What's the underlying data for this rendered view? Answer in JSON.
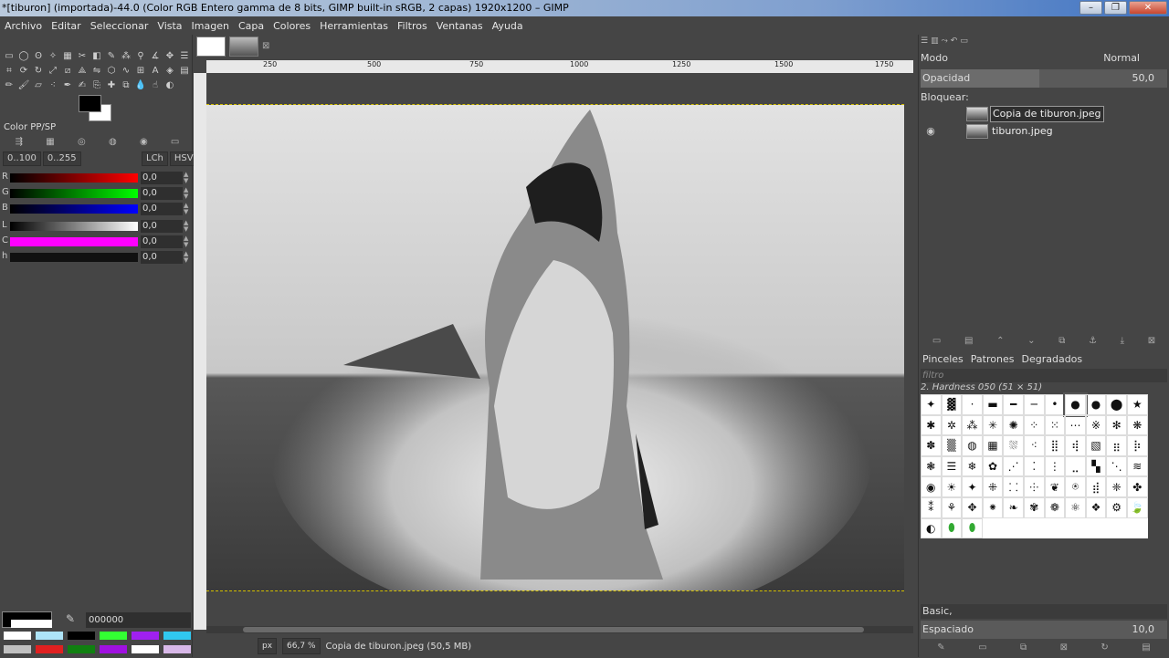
{
  "window": {
    "title": "*[tiburon] (importada)-44.0 (Color RGB Entero gamma de 8 bits, GIMP built-in sRGB, 2 capas) 1920x1200 – GIMP",
    "minimize": "–",
    "maximize": "❐",
    "close": "✕"
  },
  "menu": [
    "Archivo",
    "Editar",
    "Seleccionar",
    "Vista",
    "Imagen",
    "Capa",
    "Colores",
    "Herramientas",
    "Filtros",
    "Ventanas",
    "Ayuda"
  ],
  "color_dock": {
    "title": "Color PP/SP",
    "range1": "0..100",
    "range2": "0..255",
    "mode1": "LCh",
    "mode2": "HSV",
    "channels": [
      {
        "label": "R",
        "value": "0,0",
        "color": "#e00000"
      },
      {
        "label": "G",
        "value": "0,0",
        "color": "#00c800"
      },
      {
        "label": "B",
        "value": "0,0",
        "color": "#0000e0"
      },
      {
        "label": "L",
        "value": "0,0",
        "color": "#ffffff"
      },
      {
        "label": "C",
        "value": "0,0",
        "color": "#ff00ff"
      },
      {
        "label": "h",
        "value": "0,0",
        "color": "#111111"
      }
    ],
    "hex": "000000",
    "swatches": [
      "#ffffff",
      "#aee4f8",
      "#000000",
      "#33ff33",
      "#a020f0",
      "#30c8f0",
      "#c0c0c0",
      "#e02020",
      "#108010",
      "#a010e0",
      "#ffffff",
      "#d8b8e8"
    ]
  },
  "ruler": {
    "ticks": [
      "250",
      "500",
      "750",
      "1000",
      "1250",
      "1500",
      "1750"
    ]
  },
  "status": {
    "unit": "px",
    "zoom": "66,7 %",
    "info": "Copia de tiburon.jpeg (50,5 MB)"
  },
  "layers": {
    "mode_label": "Modo",
    "mode_value": "Normal",
    "opacity_label": "Opacidad",
    "opacity_value": "50,0",
    "lock_label": "Bloquear:",
    "items": [
      {
        "name": "Copia de tiburon.jpeg",
        "visible": false
      },
      {
        "name": "tiburon.jpeg",
        "visible": true
      }
    ]
  },
  "brushes": {
    "tabs": [
      "Pinceles",
      "Patrones",
      "Degradados"
    ],
    "filter_placeholder": "filtro",
    "current": "2. Hardness 050 (51 × 51)",
    "tag": "Basic,",
    "spacing_label": "Espaciado",
    "spacing_value": "10,0"
  }
}
